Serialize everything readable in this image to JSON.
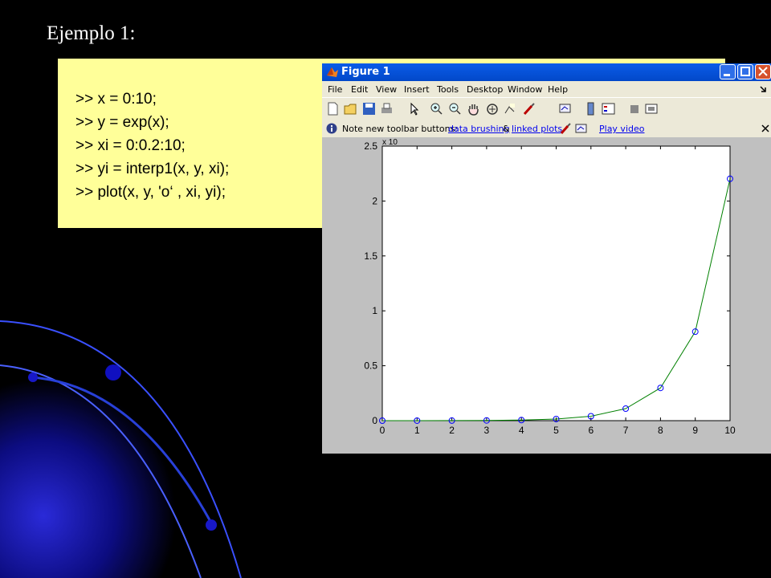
{
  "slide": {
    "title": "Ejemplo 1:",
    "code": [
      ">> x = 0:10;",
      ">> y = exp(x);",
      ">> xi = 0:0.2:10;",
      ">> yi = interp1(x, y, xi);",
      ">> plot(x, y, 'o‘ , xi, yi);"
    ]
  },
  "window": {
    "title": "Figure 1",
    "menu": [
      "File",
      "Edit",
      "View",
      "Insert",
      "Tools",
      "Desktop",
      "Window",
      "Help"
    ],
    "note": {
      "prefix": "Note new toolbar buttons:",
      "link1": "data brushing",
      "amp": "&",
      "link2": "linked plots",
      "link3": "Play video"
    },
    "toolbar_icons": [
      "new-figure-icon",
      "open-file-icon",
      "save-icon",
      "print-icon",
      "pointer-icon",
      "zoom-in-icon",
      "zoom-out-icon",
      "pan-icon",
      "rotate-icon",
      "data-cursor-icon",
      "brush-icon",
      "link-plot-icon",
      "colorbar-icon",
      "legend-icon",
      "hide-plot-tools-icon",
      "show-plot-tools-icon"
    ]
  },
  "chart_data": {
    "type": "line",
    "exponent_label": "x 10",
    "xlim": [
      0,
      10
    ],
    "ylim": [
      0,
      2.5
    ],
    "x_ticks": [
      "0",
      "1",
      "2",
      "3",
      "4",
      "5",
      "6",
      "7",
      "8",
      "9",
      "10"
    ],
    "y_ticks": [
      "0",
      "0.5",
      "1",
      "1.5",
      "2",
      "2.5"
    ],
    "markers": {
      "x": [
        0,
        1,
        2,
        3,
        4,
        5,
        6,
        7,
        8,
        9,
        10
      ],
      "y": [
        0.0,
        0.0003,
        0.0007,
        0.002,
        0.0055,
        0.0148,
        0.0403,
        0.1097,
        0.2981,
        0.8103,
        2.2026
      ],
      "color": "#0000ff"
    },
    "line": {
      "x": [
        0,
        1,
        2,
        3,
        4,
        5,
        6,
        7,
        8,
        9,
        10
      ],
      "y": [
        0.0,
        0.0003,
        0.0007,
        0.002,
        0.0055,
        0.0148,
        0.0403,
        0.1097,
        0.2981,
        0.8103,
        2.2026
      ],
      "color": "#008000"
    }
  }
}
